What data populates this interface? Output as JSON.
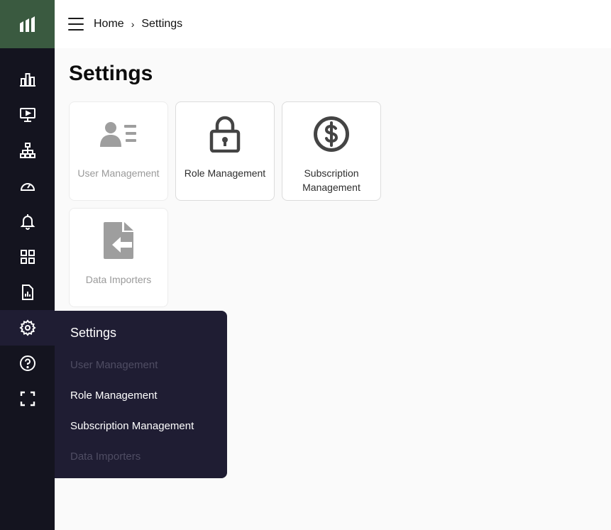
{
  "header": {
    "breadcrumb": {
      "home": "Home",
      "separator": "›",
      "current": "Settings"
    }
  },
  "page": {
    "title": "Settings"
  },
  "cards": [
    {
      "label": "User Management",
      "icon": "user-list-icon",
      "enabled": false
    },
    {
      "label": "Role Management",
      "icon": "lock-icon",
      "enabled": true
    },
    {
      "label": "Subscription Management",
      "icon": "dollar-circle-icon",
      "enabled": true
    },
    {
      "label": "Data Importers",
      "icon": "file-import-icon",
      "enabled": false
    }
  ],
  "sidebar": {
    "logo_icon": "bars-logo-icon",
    "items": [
      {
        "icon": "bar-chart-icon"
      },
      {
        "icon": "monitor-play-icon"
      },
      {
        "icon": "hierarchy-icon"
      },
      {
        "icon": "gauge-icon"
      },
      {
        "icon": "bell-icon"
      },
      {
        "icon": "grid-icon"
      },
      {
        "icon": "report-file-icon"
      },
      {
        "icon": "gear-icon",
        "active": true
      },
      {
        "icon": "help-circle-icon"
      },
      {
        "icon": "fullscreen-icon"
      }
    ]
  },
  "flyout": {
    "title": "Settings",
    "items": [
      {
        "label": "User Management",
        "enabled": false
      },
      {
        "label": "Role Management",
        "enabled": true
      },
      {
        "label": "Subscription Management",
        "enabled": true
      },
      {
        "label": "Data Importers",
        "enabled": false
      }
    ]
  },
  "colors": {
    "sidebar_bg": "#14141f",
    "logo_bg": "#3a5a40",
    "flyout_bg": "#1f1d33",
    "disabled_text": "#9a9a9a"
  }
}
